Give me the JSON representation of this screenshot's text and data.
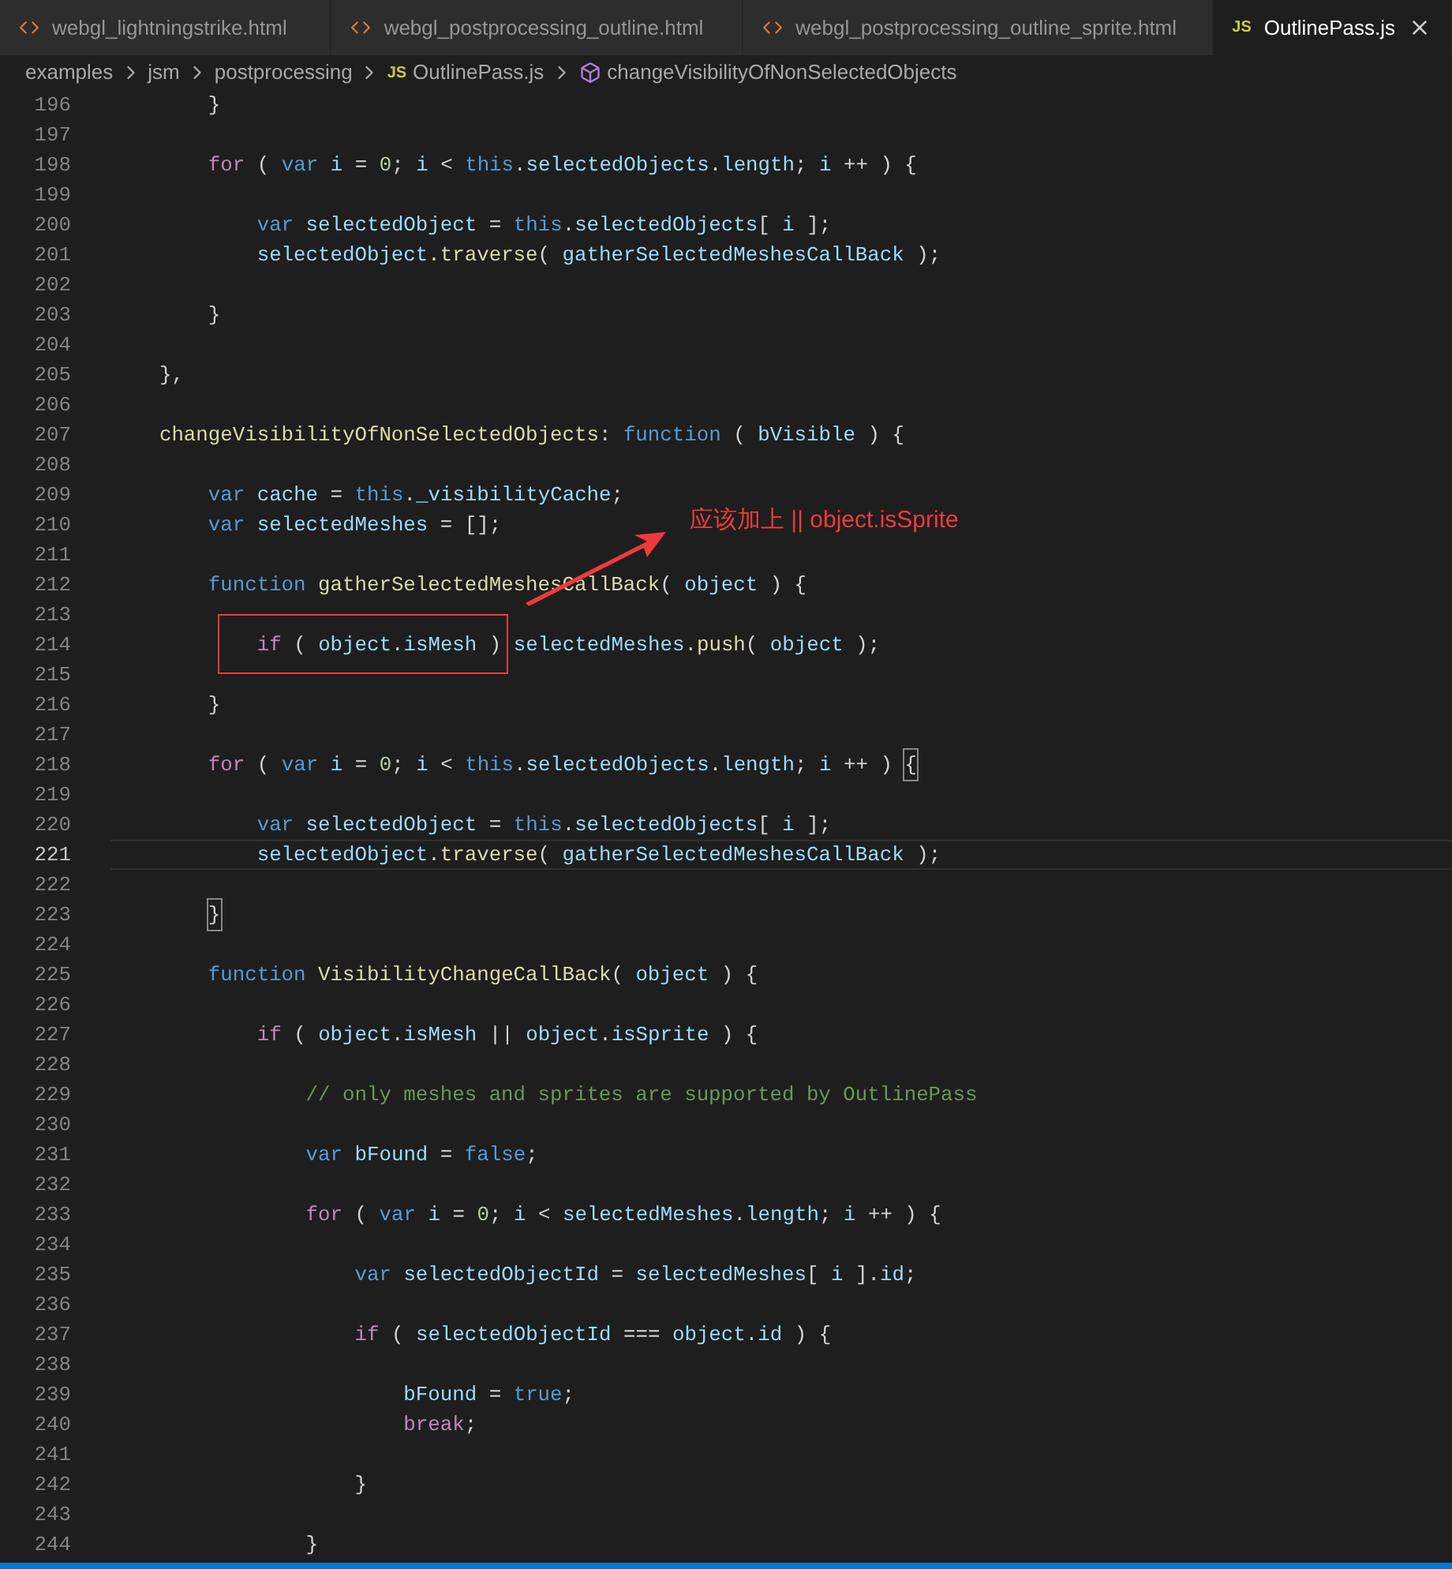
{
  "tabs": [
    {
      "label": "webgl_lightningstrike.html",
      "kind": "html",
      "selected": false
    },
    {
      "label": "webgl_postprocessing_outline.html",
      "kind": "html",
      "selected": false
    },
    {
      "label": "webgl_postprocessing_outline_sprite.html",
      "kind": "html",
      "selected": false
    },
    {
      "label": "OutlinePass.js",
      "kind": "js",
      "icon_text": "JS",
      "selected": true
    }
  ],
  "breadcrumb": [
    {
      "label": "examples",
      "kind": "folder"
    },
    {
      "label": "jsm",
      "kind": "folder"
    },
    {
      "label": "postprocessing",
      "kind": "folder"
    },
    {
      "label": "OutlinePass.js",
      "kind": "js",
      "icon_text": "JS"
    },
    {
      "label": "changeVisibilityOfNonSelectedObjects",
      "kind": "method"
    }
  ],
  "lines": [
    {
      "number": "196",
      "tokens": [
        {
          "kind": "plain",
          "text": "        }"
        }
      ]
    },
    {
      "number": "197"
    },
    {
      "number": "198",
      "tokens": [
        {
          "kind": "control",
          "text": "        for"
        },
        {
          "kind": "plain",
          "text": " ( "
        },
        {
          "kind": "storage",
          "text": "var "
        },
        {
          "kind": "variable",
          "text": "i"
        },
        {
          "kind": "plain",
          "text": " = "
        },
        {
          "kind": "number",
          "text": "0"
        },
        {
          "kind": "plain",
          "text": "; "
        },
        {
          "kind": "variable",
          "text": "i"
        },
        {
          "kind": "plain",
          "text": " < "
        },
        {
          "kind": "storage",
          "text": "this"
        },
        {
          "kind": "plain",
          "text": "."
        },
        {
          "kind": "variable",
          "text": "selectedObjects"
        },
        {
          "kind": "plain",
          "text": "."
        },
        {
          "kind": "variable",
          "text": "length"
        },
        {
          "kind": "plain",
          "text": "; "
        },
        {
          "kind": "variable",
          "text": "i"
        },
        {
          "kind": "plain",
          "text": " ++ ) {"
        }
      ]
    },
    {
      "number": "199"
    },
    {
      "number": "200",
      "tokens": [
        {
          "kind": "storage",
          "text": "            var "
        },
        {
          "kind": "variable",
          "text": "selectedObject"
        },
        {
          "kind": "plain",
          "text": " = "
        },
        {
          "kind": "storage",
          "text": "this"
        },
        {
          "kind": "plain",
          "text": "."
        },
        {
          "kind": "variable",
          "text": "selectedObjects"
        },
        {
          "kind": "plain",
          "text": "[ "
        },
        {
          "kind": "variable",
          "text": "i"
        },
        {
          "kind": "plain",
          "text": " ];"
        }
      ]
    },
    {
      "number": "201",
      "tokens": [
        {
          "kind": "variable",
          "text": "            selectedObject"
        },
        {
          "kind": "plain",
          "text": "."
        },
        {
          "kind": "function",
          "text": "traverse"
        },
        {
          "kind": "plain",
          "text": "( "
        },
        {
          "kind": "variable",
          "text": "gatherSelectedMeshesCallBack"
        },
        {
          "kind": "plain",
          "text": " );"
        }
      ]
    },
    {
      "number": "202"
    },
    {
      "number": "203",
      "tokens": [
        {
          "kind": "plain",
          "text": "        }"
        }
      ]
    },
    {
      "number": "204"
    },
    {
      "number": "205",
      "tokens": [
        {
          "kind": "plain",
          "text": "    },"
        }
      ]
    },
    {
      "number": "206"
    },
    {
      "number": "207",
      "tokens": [
        {
          "kind": "function",
          "text": "    changeVisibilityOfNonSelectedObjects"
        },
        {
          "kind": "plain",
          "text": ": "
        },
        {
          "kind": "storage",
          "text": "function"
        },
        {
          "kind": "plain",
          "text": " ( "
        },
        {
          "kind": "variable",
          "text": "bVisible"
        },
        {
          "kind": "plain",
          "text": " ) {"
        }
      ]
    },
    {
      "number": "208"
    },
    {
      "number": "209",
      "tokens": [
        {
          "kind": "storage",
          "text": "        var "
        },
        {
          "kind": "variable",
          "text": "cache"
        },
        {
          "kind": "plain",
          "text": " = "
        },
        {
          "kind": "storage",
          "text": "this"
        },
        {
          "kind": "plain",
          "text": "."
        },
        {
          "kind": "variable",
          "text": "_visibilityCache"
        },
        {
          "kind": "plain",
          "text": ";"
        }
      ]
    },
    {
      "number": "210",
      "tokens": [
        {
          "kind": "storage",
          "text": "        var "
        },
        {
          "kind": "variable",
          "text": "selectedMeshes"
        },
        {
          "kind": "plain",
          "text": " = [];"
        }
      ]
    },
    {
      "number": "211"
    },
    {
      "number": "212",
      "tokens": [
        {
          "kind": "storage",
          "text": "        function "
        },
        {
          "kind": "function",
          "text": "gatherSelectedMeshesCallBack"
        },
        {
          "kind": "plain",
          "text": "( "
        },
        {
          "kind": "variable",
          "text": "object"
        },
        {
          "kind": "plain",
          "text": " ) {"
        }
      ]
    },
    {
      "number": "213"
    },
    {
      "number": "214",
      "tokens": [
        {
          "kind": "control",
          "text": "            if"
        },
        {
          "kind": "plain",
          "text": " ( "
        },
        {
          "kind": "variable",
          "text": "object"
        },
        {
          "kind": "plain",
          "text": "."
        },
        {
          "kind": "variable",
          "text": "isMesh"
        },
        {
          "kind": "plain",
          "text": " ) "
        },
        {
          "kind": "variable",
          "text": "selectedMeshes"
        },
        {
          "kind": "plain",
          "text": "."
        },
        {
          "kind": "function",
          "text": "push"
        },
        {
          "kind": "plain",
          "text": "( "
        },
        {
          "kind": "variable",
          "text": "object"
        },
        {
          "kind": "plain",
          "text": " );"
        }
      ]
    },
    {
      "number": "215"
    },
    {
      "number": "216",
      "tokens": [
        {
          "kind": "plain",
          "text": "        }"
        }
      ]
    },
    {
      "number": "217"
    },
    {
      "number": "218",
      "tokens": [
        {
          "kind": "control",
          "text": "        for"
        },
        {
          "kind": "plain",
          "text": " ( "
        },
        {
          "kind": "storage",
          "text": "var "
        },
        {
          "kind": "variable",
          "text": "i"
        },
        {
          "kind": "plain",
          "text": " = "
        },
        {
          "kind": "number",
          "text": "0"
        },
        {
          "kind": "plain",
          "text": "; "
        },
        {
          "kind": "variable",
          "text": "i"
        },
        {
          "kind": "plain",
          "text": " < "
        },
        {
          "kind": "storage",
          "text": "this"
        },
        {
          "kind": "plain",
          "text": "."
        },
        {
          "kind": "variable",
          "text": "selectedObjects"
        },
        {
          "kind": "plain",
          "text": "."
        },
        {
          "kind": "variable",
          "text": "length"
        },
        {
          "kind": "plain",
          "text": "; "
        },
        {
          "kind": "variable",
          "text": "i"
        },
        {
          "kind": "plain",
          "text": " ++ ) "
        },
        {
          "kind": "bracket",
          "text": "{"
        }
      ]
    },
    {
      "number": "219"
    },
    {
      "number": "220",
      "tokens": [
        {
          "kind": "storage",
          "text": "            var "
        },
        {
          "kind": "variable",
          "text": "selectedObject"
        },
        {
          "kind": "plain",
          "text": " = "
        },
        {
          "kind": "storage",
          "text": "this"
        },
        {
          "kind": "plain",
          "text": "."
        },
        {
          "kind": "variable",
          "text": "selectedObjects"
        },
        {
          "kind": "plain",
          "text": "[ "
        },
        {
          "kind": "variable",
          "text": "i"
        },
        {
          "kind": "plain",
          "text": " ];"
        }
      ]
    },
    {
      "number": "221",
      "current": true,
      "tokens": [
        {
          "kind": "variable",
          "text": "            selectedObject"
        },
        {
          "kind": "plain",
          "text": "."
        },
        {
          "kind": "function",
          "text": "traverse"
        },
        {
          "kind": "plain",
          "text": "( "
        },
        {
          "kind": "variable",
          "text": "gatherSelectedMeshesCallBack"
        },
        {
          "kind": "plain",
          "text": " );"
        }
      ]
    },
    {
      "number": "222"
    },
    {
      "number": "223",
      "tokens": [
        {
          "kind": "bracket",
          "text": "        }"
        }
      ]
    },
    {
      "number": "224"
    },
    {
      "number": "225",
      "tokens": [
        {
          "kind": "storage",
          "text": "        function "
        },
        {
          "kind": "function",
          "text": "VisibilityChangeCallBack"
        },
        {
          "kind": "plain",
          "text": "( "
        },
        {
          "kind": "variable",
          "text": "object"
        },
        {
          "kind": "plain",
          "text": " ) {"
        }
      ]
    },
    {
      "number": "226"
    },
    {
      "number": "227",
      "tokens": [
        {
          "kind": "control",
          "text": "            if"
        },
        {
          "kind": "plain",
          "text": " ( "
        },
        {
          "kind": "variable",
          "text": "object"
        },
        {
          "kind": "plain",
          "text": "."
        },
        {
          "kind": "variable",
          "text": "isMesh"
        },
        {
          "kind": "plain",
          "text": " || "
        },
        {
          "kind": "variable",
          "text": "object"
        },
        {
          "kind": "plain",
          "text": "."
        },
        {
          "kind": "variable",
          "text": "isSprite"
        },
        {
          "kind": "plain",
          "text": " ) {"
        }
      ]
    },
    {
      "number": "228"
    },
    {
      "number": "229",
      "tokens": [
        {
          "kind": "comment",
          "text": "                // only meshes and sprites are supported by OutlinePass"
        }
      ]
    },
    {
      "number": "230"
    },
    {
      "number": "231",
      "tokens": [
        {
          "kind": "storage",
          "text": "                var "
        },
        {
          "kind": "variable",
          "text": "bFound"
        },
        {
          "kind": "plain",
          "text": " = "
        },
        {
          "kind": "storage",
          "text": "false"
        },
        {
          "kind": "plain",
          "text": ";"
        }
      ]
    },
    {
      "number": "232"
    },
    {
      "number": "233",
      "tokens": [
        {
          "kind": "control",
          "text": "                for"
        },
        {
          "kind": "plain",
          "text": " ( "
        },
        {
          "kind": "storage",
          "text": "var "
        },
        {
          "kind": "variable",
          "text": "i"
        },
        {
          "kind": "plain",
          "text": " = "
        },
        {
          "kind": "number",
          "text": "0"
        },
        {
          "kind": "plain",
          "text": "; "
        },
        {
          "kind": "variable",
          "text": "i"
        },
        {
          "kind": "plain",
          "text": " < "
        },
        {
          "kind": "variable",
          "text": "selectedMeshes"
        },
        {
          "kind": "plain",
          "text": "."
        },
        {
          "kind": "variable",
          "text": "length"
        },
        {
          "kind": "plain",
          "text": "; "
        },
        {
          "kind": "variable",
          "text": "i"
        },
        {
          "kind": "plain",
          "text": " ++ ) {"
        }
      ]
    },
    {
      "number": "234"
    },
    {
      "number": "235",
      "tokens": [
        {
          "kind": "storage",
          "text": "                    var "
        },
        {
          "kind": "variable",
          "text": "selectedObjectId"
        },
        {
          "kind": "plain",
          "text": " = "
        },
        {
          "kind": "variable",
          "text": "selectedMeshes"
        },
        {
          "kind": "plain",
          "text": "[ "
        },
        {
          "kind": "variable",
          "text": "i"
        },
        {
          "kind": "plain",
          "text": " ]."
        },
        {
          "kind": "variable",
          "text": "id"
        },
        {
          "kind": "plain",
          "text": ";"
        }
      ]
    },
    {
      "number": "236"
    },
    {
      "number": "237",
      "tokens": [
        {
          "kind": "control",
          "text": "                    if"
        },
        {
          "kind": "plain",
          "text": " ( "
        },
        {
          "kind": "variable",
          "text": "selectedObjectId"
        },
        {
          "kind": "plain",
          "text": " === "
        },
        {
          "kind": "variable",
          "text": "object"
        },
        {
          "kind": "plain",
          "text": "."
        },
        {
          "kind": "variable",
          "text": "id"
        },
        {
          "kind": "plain",
          "text": " ) {"
        }
      ]
    },
    {
      "number": "238"
    },
    {
      "number": "239",
      "tokens": [
        {
          "kind": "variable",
          "text": "                        bFound"
        },
        {
          "kind": "plain",
          "text": " = "
        },
        {
          "kind": "storage",
          "text": "true"
        },
        {
          "kind": "plain",
          "text": ";"
        }
      ]
    },
    {
      "number": "240",
      "tokens": [
        {
          "kind": "control",
          "text": "                        break"
        },
        {
          "kind": "plain",
          "text": ";"
        }
      ]
    },
    {
      "number": "241"
    },
    {
      "number": "242",
      "tokens": [
        {
          "kind": "plain",
          "text": "                    }"
        }
      ]
    },
    {
      "number": "243"
    },
    {
      "number": "244",
      "tokens": [
        {
          "kind": "plain",
          "text": "                }"
        }
      ]
    }
  ],
  "annotation": {
    "text": "应该加上 || object.isSprite",
    "color": "#f03a3a"
  }
}
